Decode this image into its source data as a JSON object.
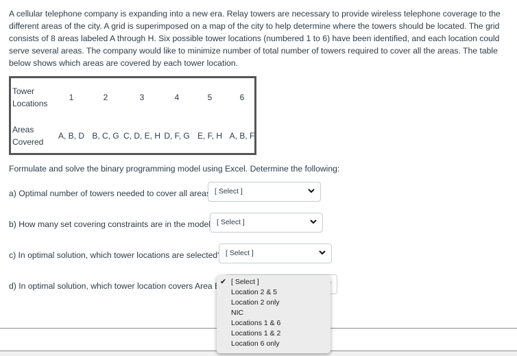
{
  "intro": "A cellular telephone company is expanding into a new era. Relay towers are necessary to provide wireless telephone coverage to the different areas of the city. A grid is superimposed on a map of the city to help determine where the towers should be located. The grid consists of 8 areas labeled A through H. Six possible tower locations (numbered 1 to 6) have been identified, and each location could serve several areas. The company would like to minimize number of total number of towers required to cover all the areas.  The table below shows which areas are covered by each tower location.",
  "table": {
    "row_headers": [
      "Tower\nLocations",
      "Areas\nCovered"
    ],
    "header_line1": [
      "Tower",
      "Areas"
    ],
    "header_line2": [
      "Locations",
      "Covered"
    ],
    "locations": [
      "1",
      "2",
      "3",
      "4",
      "5",
      "6"
    ],
    "areas": [
      "A, B, D",
      "B, C, G",
      "C, D, E, H",
      "D, F, G",
      "E, F, H",
      "A, B, F"
    ]
  },
  "instructions": "Formulate and solve the binary programming model using Excel.  Determine the following:",
  "questions": [
    {
      "text": "a) Optimal number of towers needed to cover all areas.",
      "selected": "[ Select ]"
    },
    {
      "text": "b) How many set covering constraints are in the model?",
      "selected": "[ Select ]"
    },
    {
      "text": "c) In optimal solution, which tower locations are selected?",
      "selected": "[ Select ]"
    },
    {
      "text": "d)  In optimal solution, which tower location covers Area B?",
      "selected": "[ Select ]"
    }
  ],
  "dropdown": {
    "checked_index": 0,
    "options": [
      "[ Select ]",
      "Location 2 & 5",
      "Location 2 only",
      "NIC",
      "Locations 1 & 6",
      "Locations 1 & 2",
      "Location 6 only"
    ]
  }
}
